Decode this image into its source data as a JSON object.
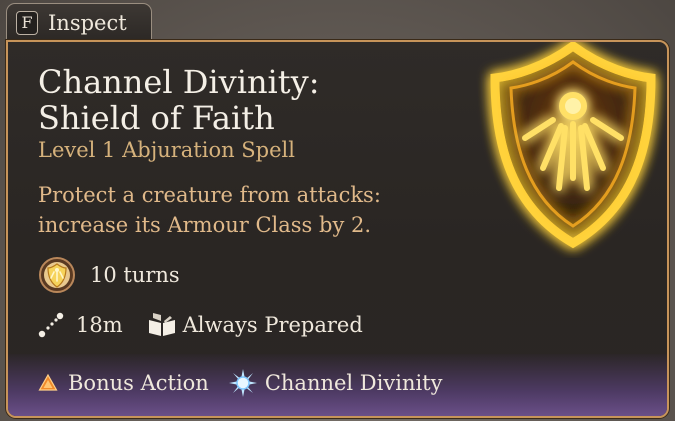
{
  "inspect": {
    "key": "F",
    "label": "Inspect"
  },
  "spell": {
    "title_line1": "Channel Divinity:",
    "title_line2": "Shield of Faith",
    "subtitle": "Level 1 Abjuration Spell",
    "description_line1": "Protect a creature from attacks:",
    "description_line2": "increase its Armour Class by 2."
  },
  "details": {
    "duration": "10 turns",
    "range": "18m",
    "preparation": "Always Prepared"
  },
  "costs": {
    "action": "Bonus Action",
    "resource": "Channel Divinity"
  },
  "icons": {
    "spell_art": "glowing-shield-icon",
    "duration": "shield-medallion-icon",
    "range": "dotted-line-range-icon",
    "preparation": "open-book-icon",
    "action": "orange-triangle-icon",
    "resource": "blue-starburst-icon"
  },
  "colors": {
    "panel_border": "#c7945a",
    "subtitle": "#d6b27c",
    "description": "#e0b98a",
    "glow": "#ffcc33",
    "footer": "#6a4f88"
  }
}
